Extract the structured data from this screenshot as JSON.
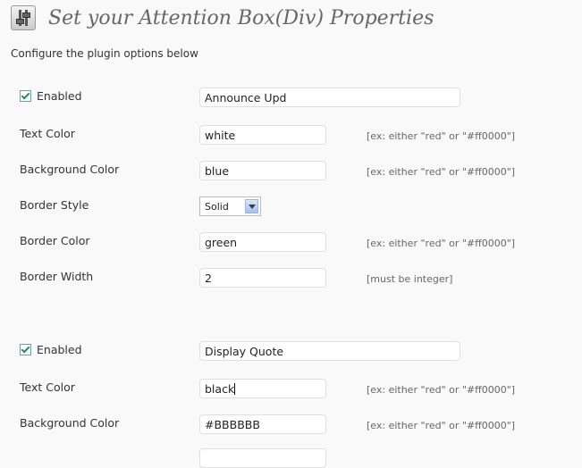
{
  "header": {
    "title": "Set your Attention Box(Div) Properties",
    "icon": "settings-sliders-icon"
  },
  "intro": "Configure the plugin options below",
  "boxes": [
    {
      "enabled_label": "Enabled",
      "enabled": true,
      "name": "Announce Upd",
      "text_color_label": "Text Color",
      "text_color": "white",
      "text_color_hint": "[ex: either \"red\" or \"#ff0000\"]",
      "bg_color_label": "Background Color",
      "bg_color": "blue",
      "bg_color_hint": "[ex: either \"red\" or \"#ff0000\"]",
      "border_style_label": "Border Style",
      "border_style": "Solid",
      "border_color_label": "Border Color",
      "border_color": "green",
      "border_color_hint": "[ex: either \"red\" or \"#ff0000\"]",
      "border_width_label": "Border Width",
      "border_width": "2",
      "border_width_hint": "[must be integer]"
    },
    {
      "enabled_label": "Enabled",
      "enabled": true,
      "name": "Display Quote",
      "text_color_label": "Text Color",
      "text_color": "black",
      "text_color_hint": "[ex: either \"red\" or \"#ff0000\"]",
      "bg_color_label": "Background Color",
      "bg_color": "#BBBBBB",
      "bg_color_hint": "[ex: either \"red\" or \"#ff0000\"]"
    }
  ]
}
